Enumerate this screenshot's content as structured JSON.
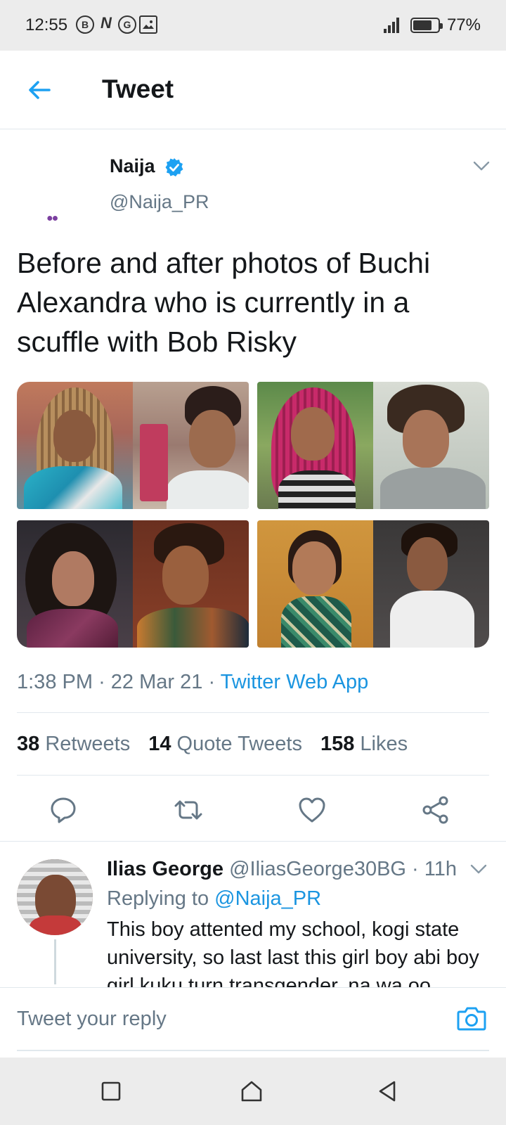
{
  "status_bar": {
    "time": "12:55",
    "battery": "77%",
    "battery_level": 0.77,
    "notification_icons": [
      "b-icon",
      "n-icon",
      "swirl-icon",
      "image-icon"
    ]
  },
  "header": {
    "title": "Tweet"
  },
  "tweet": {
    "author_name": "Naija",
    "author_handle": "@Naija_PR",
    "verified": true,
    "text": "Before and after photos of Buchi Alexandra who is currently in a scuffle with Bob Risky",
    "time": "1:38 PM",
    "date": "22 Mar 21",
    "separator": "·",
    "source": "Twitter Web App",
    "stats": {
      "retweets_count": "38",
      "retweets_label": "Retweets",
      "quotes_count": "14",
      "quotes_label": "Quote Tweets",
      "likes_count": "158",
      "likes_label": "Likes"
    },
    "media_count": 4
  },
  "reply": {
    "name": "Ilias George",
    "handle": "@IliasGeorge30BG",
    "time": "· 11h",
    "replying_label": "Replying to",
    "replying_to": "@Naija_PR",
    "text": "This boy attented my school, kogi state university, so last last this girl boy abi boy girl kuku turn transgender, na wa oo"
  },
  "composer": {
    "placeholder": "Tweet your reply"
  },
  "colors": {
    "accent": "#1da1f2",
    "link": "#1b95e0",
    "text": "#14171a",
    "muted": "#657786",
    "border": "#e1e8ed"
  }
}
